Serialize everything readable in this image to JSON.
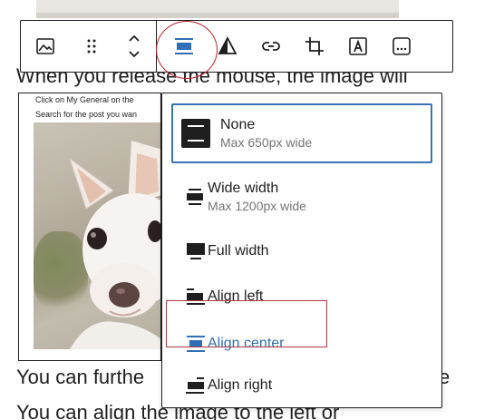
{
  "background": {
    "line_top": "When you release the mouse, the image will",
    "line_middle_left": "You can furthe",
    "line_middle_right": "e",
    "line_bottom": "You can align the image to the left or"
  },
  "image_block": {
    "caption_1": "Click on My General on the",
    "caption_2": "Search for the post you wan"
  },
  "toolbar": {
    "buttons": [
      {
        "icon": "image-icon"
      },
      {
        "icon": "drag-handle-icon"
      },
      {
        "icon": "move-up-down-icon"
      },
      {
        "icon": "align-center-icon",
        "active": true
      },
      {
        "icon": "duotone-filter-icon"
      },
      {
        "icon": "link-icon"
      },
      {
        "icon": "crop-icon"
      },
      {
        "icon": "text-overlay-icon"
      },
      {
        "icon": "more-options-icon"
      }
    ]
  },
  "alignment_menu": {
    "items": [
      {
        "label": "None",
        "info": "Max 650px wide",
        "selected": true
      },
      {
        "label": "Wide width",
        "info": "Max 1200px wide"
      },
      {
        "label": "Full width"
      },
      {
        "label": "Align left"
      },
      {
        "label": "Align center",
        "active": true
      },
      {
        "label": "Align right"
      }
    ]
  },
  "colors": {
    "accent": "#3a72b5",
    "active_text": "#2f6fb4",
    "annotation_red": "#c0202a",
    "border": "#1e1e1e"
  }
}
